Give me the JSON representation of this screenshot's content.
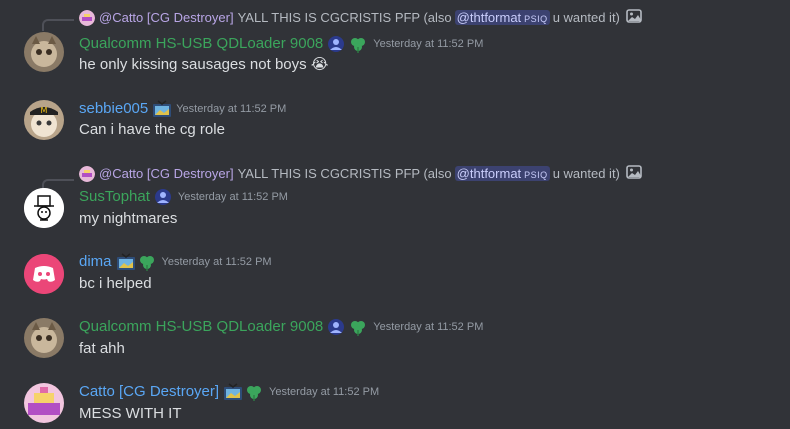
{
  "colors": {
    "background": "#313338",
    "green_role": "#3ba55c",
    "blue_role": "#5aa7f5",
    "reply_name": "#b9a6e6",
    "timestamp": "#949ba4"
  },
  "messages": [
    {
      "reply": {
        "author": "@Catto [CG Destroyer]",
        "text_before": "YALL THIS IS CGCRISTIS PFP (also",
        "mention": "@thtformat",
        "mention_tag": "PSIQ",
        "text_after": "u wanted it)"
      },
      "username": "Qualcomm HS-USB QDLoader 9008",
      "timestamp": "Yesterday at 11:52 PM",
      "content": "he only kissing sausages not boys",
      "emoji": "😭"
    },
    {
      "username": "sebbie005",
      "timestamp": "Yesterday at 11:52 PM",
      "content": "Can i have the cg role"
    },
    {
      "reply": {
        "author": "@Catto [CG Destroyer]",
        "text_before": "YALL THIS IS CGCRISTIS PFP (also",
        "mention": "@thtformat",
        "mention_tag": "PSIQ",
        "text_after": "u wanted it)"
      },
      "username": "SusTophat",
      "timestamp": "Yesterday at 11:52 PM",
      "content": "my nightmares"
    },
    {
      "username": "dima",
      "timestamp": "Yesterday at 11:52 PM",
      "content": "bc i helped"
    },
    {
      "username": "Qualcomm HS-USB QDLoader 9008",
      "timestamp": "Yesterday at 11:52 PM",
      "content": "fat ahh"
    },
    {
      "username": "Catto [CG Destroyer]",
      "timestamp": "Yesterday at 11:52 PM",
      "content": "MESS WITH IT"
    }
  ]
}
